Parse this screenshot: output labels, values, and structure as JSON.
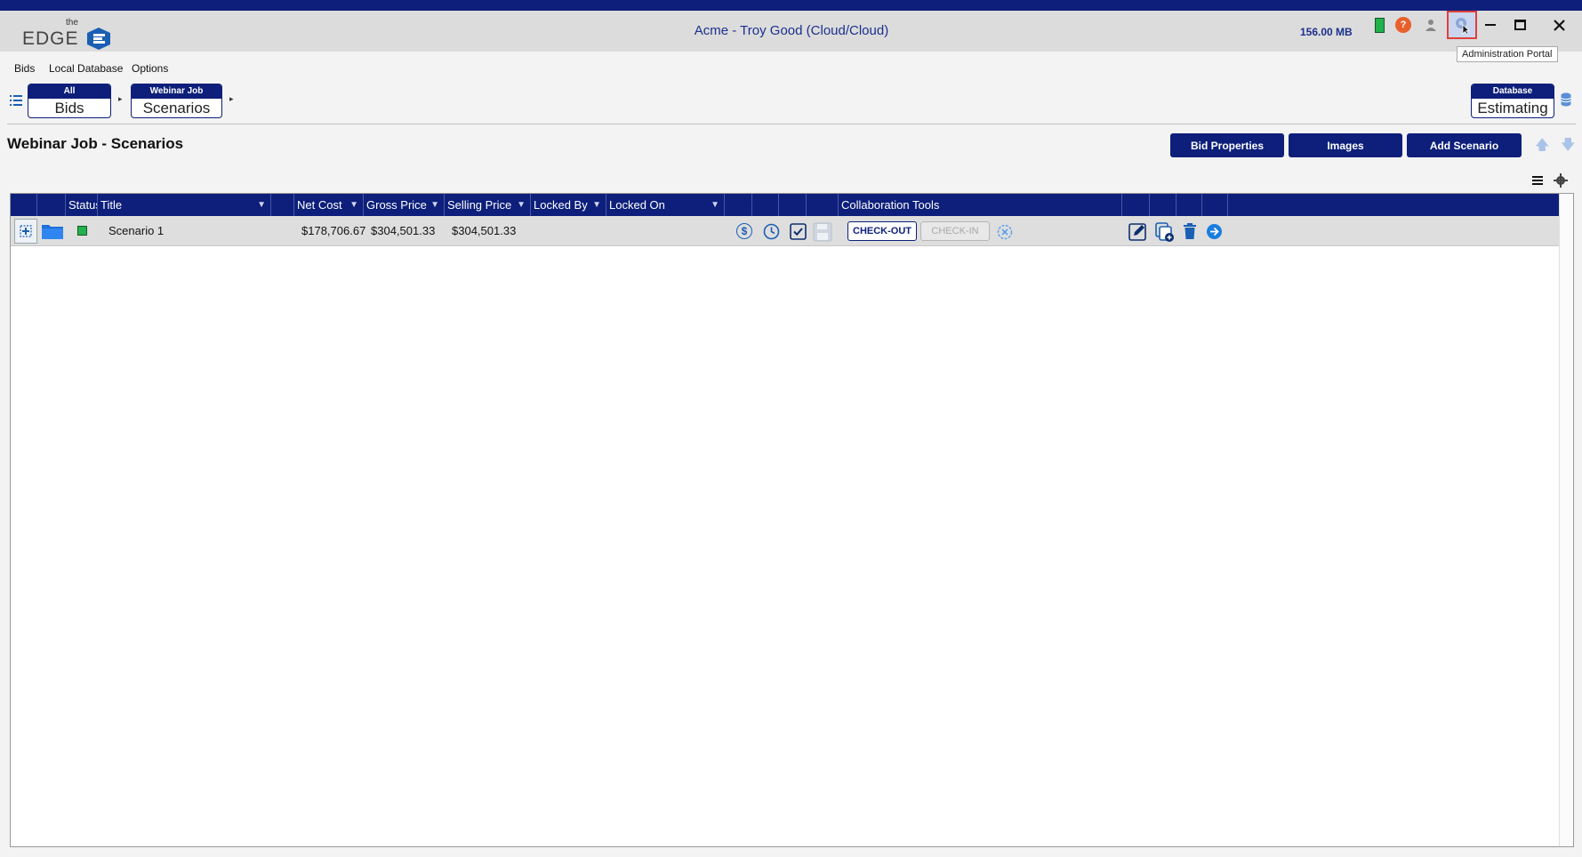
{
  "app": {
    "logo_the": "the",
    "logo_word": "EDGE",
    "title": "Acme  - Troy  Good (Cloud/Cloud)",
    "memory": "156.00 MB",
    "tooltip": "Administration Portal",
    "icons": [
      "status-green-icon",
      "help-icon",
      "user-icon",
      "gear-icon",
      "minimize-icon",
      "maximize-icon",
      "close-icon"
    ]
  },
  "menu": [
    "Bids",
    "Local Database",
    "Options"
  ],
  "breadcrumb": [
    {
      "small": "All",
      "big": "Bids"
    },
    {
      "small": "Webinar Job",
      "big": "Scenarios"
    }
  ],
  "database": {
    "small": "Database",
    "big": "Estimating"
  },
  "page": {
    "title": "Webinar Job - Scenarios",
    "buttons": [
      "Bid Properties",
      "Images",
      "Add Scenario"
    ]
  },
  "grid": {
    "headers": {
      "status": "Status",
      "title": "Title",
      "net_cost": "Net Cost",
      "gross_price": "Gross Price",
      "selling_price": "Selling Price",
      "locked_by": "Locked By",
      "locked_on": "Locked On",
      "collab": "Collaboration Tools"
    },
    "rows": [
      {
        "title": "Scenario 1",
        "net_cost": "$178,706.67",
        "gross_price": "$304,501.33",
        "selling_price": "$304,501.33",
        "locked_by": "",
        "locked_on": "",
        "checkout": "CHECK-OUT",
        "checkin": "CHECK-IN"
      }
    ]
  },
  "colors": {
    "brand": "#0d1f7a",
    "accent": "#1a5fb4",
    "status_ok": "#22b14c",
    "highlight": "#e0403a"
  }
}
